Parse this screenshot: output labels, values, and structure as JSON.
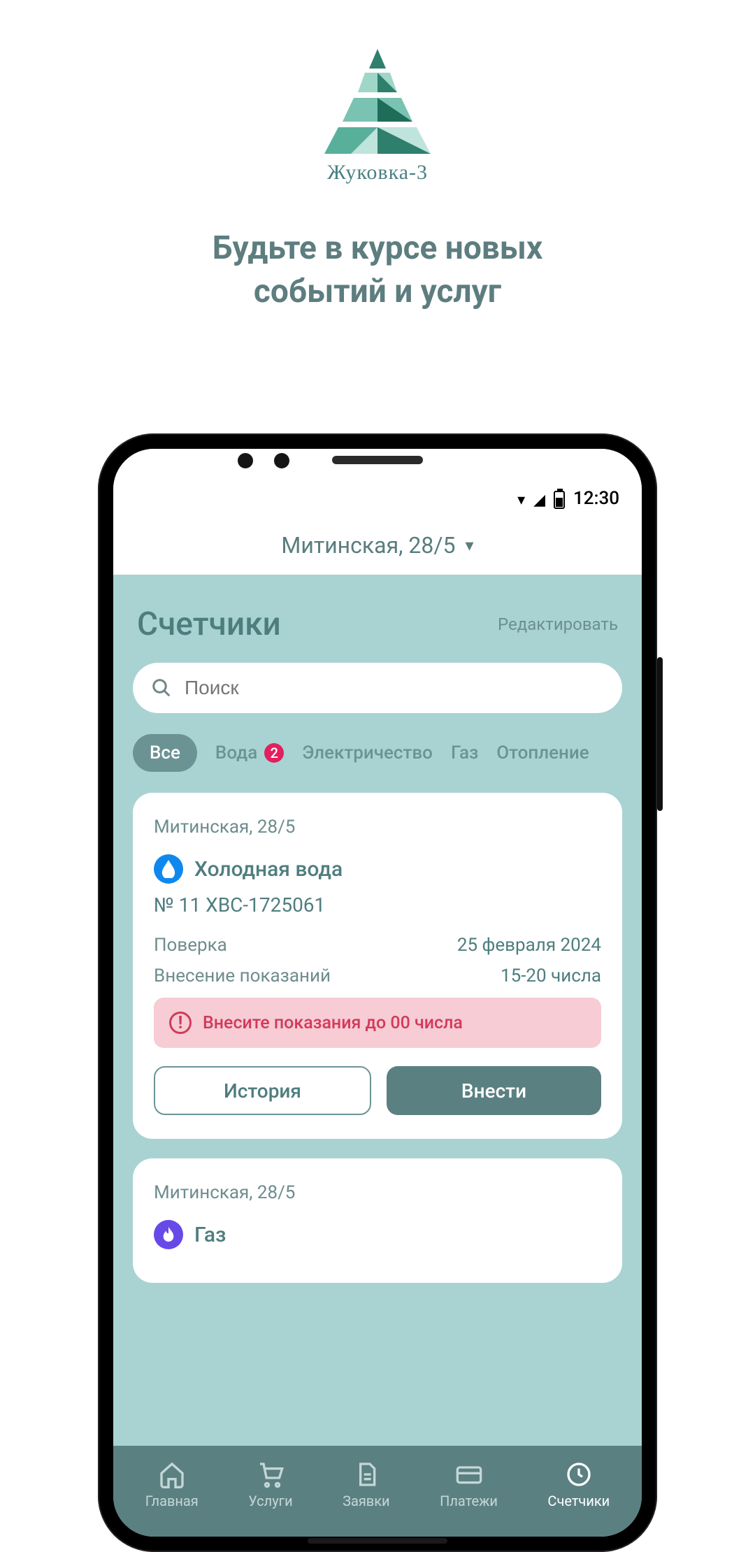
{
  "brand": {
    "name": "Жуковка-3"
  },
  "tagline_line1": "Будьте в курсе новых",
  "tagline_line2": "событий и услуг",
  "statusbar": {
    "time": "12:30"
  },
  "address_selector": {
    "current": "Митинская, 28/5"
  },
  "page": {
    "title": "Счетчики",
    "edit": "Редактировать"
  },
  "search": {
    "placeholder": "Поиск"
  },
  "filters": {
    "all": {
      "label": "Все"
    },
    "water": {
      "label": "Вода",
      "badge": "2"
    },
    "elec": {
      "label": "Электричество"
    },
    "gas": {
      "label": "Газ"
    },
    "heat": {
      "label": "Отопление"
    }
  },
  "meter1": {
    "address": "Митинская, 28/5",
    "name": "Холодная вода",
    "number": "№ 11 ХВС-1725061",
    "check_label": "Поверка",
    "check_value": "25 февраля 2024",
    "submit_label": "Внесение показаний",
    "submit_value": "15-20 числа",
    "alert": "Внесите показания до 00 числа",
    "history_btn": "История",
    "submit_btn": "Внести"
  },
  "meter2": {
    "address": "Митинская, 28/5",
    "name": "Газ"
  },
  "nav": {
    "home": "Главная",
    "services": "Услуги",
    "requests": "Заявки",
    "payments": "Платежи",
    "meters": "Счетчики"
  }
}
